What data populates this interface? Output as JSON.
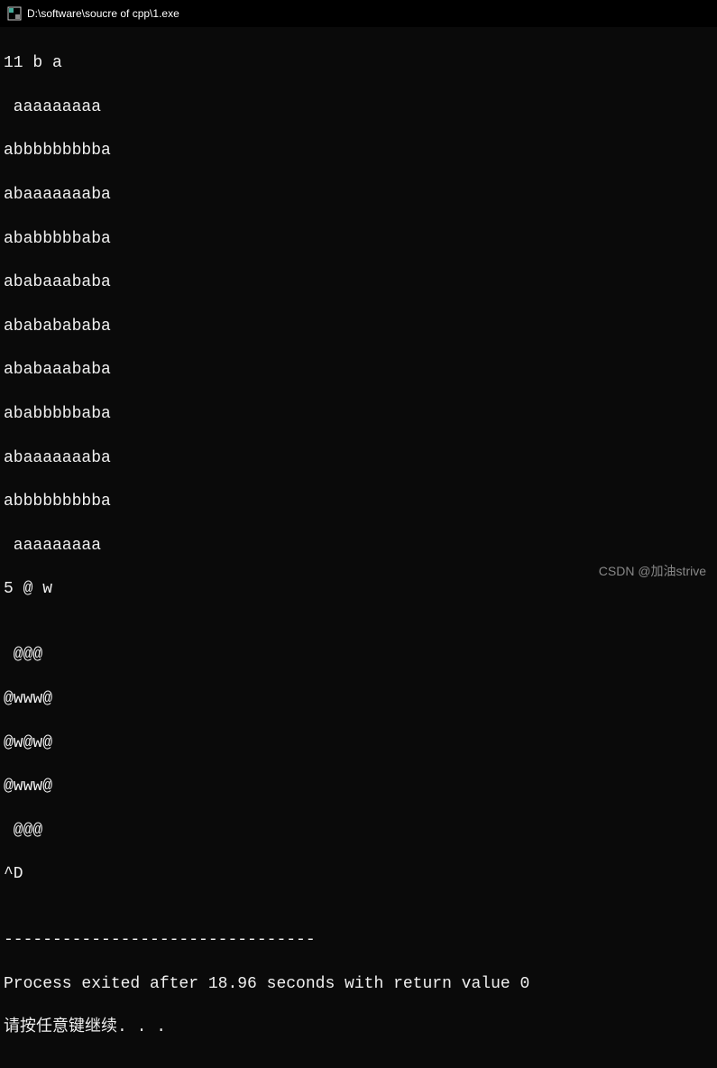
{
  "titlebar": {
    "title": "D:\\software\\soucre of cpp\\1.exe"
  },
  "console": {
    "lines": [
      "11 b a",
      " aaaaaaaaa",
      "abbbbbbbbba",
      "abaaaaaaaba",
      "ababbbbbaba",
      "ababaaababa",
      "abababababa",
      "ababaaababa",
      "ababbbbbaba",
      "abaaaaaaaba",
      "abbbbbbbbba",
      " aaaaaaaaa",
      "5 @ w",
      "",
      " @@@",
      "@www@",
      "@w@w@",
      "@www@",
      " @@@",
      "^D",
      "",
      "--------------------------------",
      "Process exited after 18.96 seconds with return value 0",
      "请按任意键继续. . ."
    ]
  },
  "watermark": {
    "text": "CSDN @加油strive"
  }
}
